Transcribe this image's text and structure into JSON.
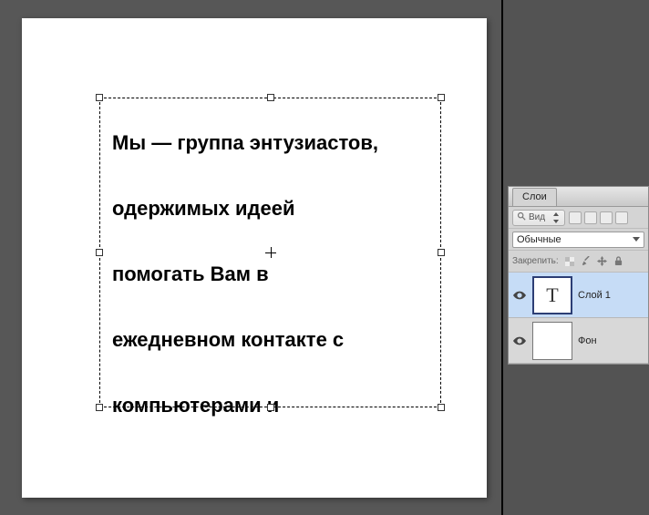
{
  "canvas": {
    "text": "Мы — группа энтузиастов,\nодержимых идеей\nпомогать Вам в\nежедневном контакте с\nкомпьютерами и"
  },
  "layersPanel": {
    "tab": "Слои",
    "searchLabel": "Вид",
    "blendMode": "Обычные",
    "lockLabel": "Закрепить:",
    "layers": [
      {
        "name": "Слой 1",
        "type": "text",
        "selected": true,
        "glyph": "T"
      },
      {
        "name": "Фон",
        "type": "bg",
        "selected": false
      }
    ]
  }
}
